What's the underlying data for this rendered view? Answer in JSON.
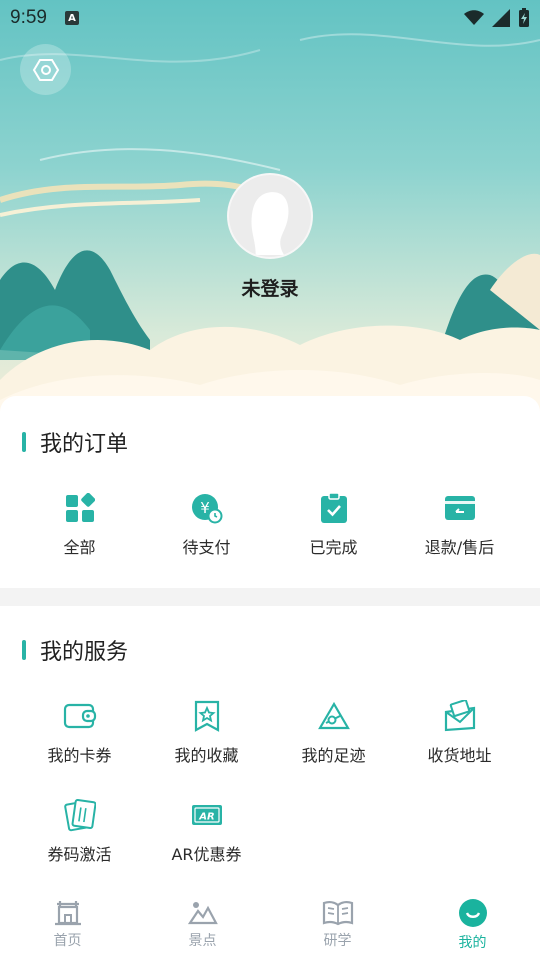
{
  "status_bar": {
    "time": "9:59",
    "notif_badge": "A"
  },
  "profile": {
    "username": "未登录"
  },
  "orders": {
    "title": "我的订单",
    "items": [
      {
        "label": "全部",
        "icon": "grid-apps-icon"
      },
      {
        "label": "待支付",
        "icon": "yen-clock-icon"
      },
      {
        "label": "已完成",
        "icon": "clipboard-check-icon"
      },
      {
        "label": "退款/售后",
        "icon": "refund-card-icon"
      }
    ]
  },
  "services": {
    "title": "我的服务",
    "items": [
      {
        "label": "我的卡券",
        "icon": "wallet-icon"
      },
      {
        "label": "我的收藏",
        "icon": "bookmark-star-icon"
      },
      {
        "label": "我的足迹",
        "icon": "map-pin-triangle-icon"
      },
      {
        "label": "收货地址",
        "icon": "envelope-address-icon"
      },
      {
        "label": "券码激活",
        "icon": "ticket-cards-icon"
      },
      {
        "label": "AR优惠券",
        "icon": "ar-coupon-icon"
      }
    ]
  },
  "bottom_nav": {
    "items": [
      {
        "label": "首页",
        "icon": "temple-home-icon",
        "active": false
      },
      {
        "label": "景点",
        "icon": "mountain-spot-icon",
        "active": false
      },
      {
        "label": "研学",
        "icon": "open-book-icon",
        "active": false
      },
      {
        "label": "我的",
        "icon": "smile-profile-icon",
        "active": true
      }
    ]
  },
  "colors": {
    "accent": "#1ab39e",
    "section_bar": "#28b3a6",
    "inactive_nav": "#9aa3ad"
  }
}
